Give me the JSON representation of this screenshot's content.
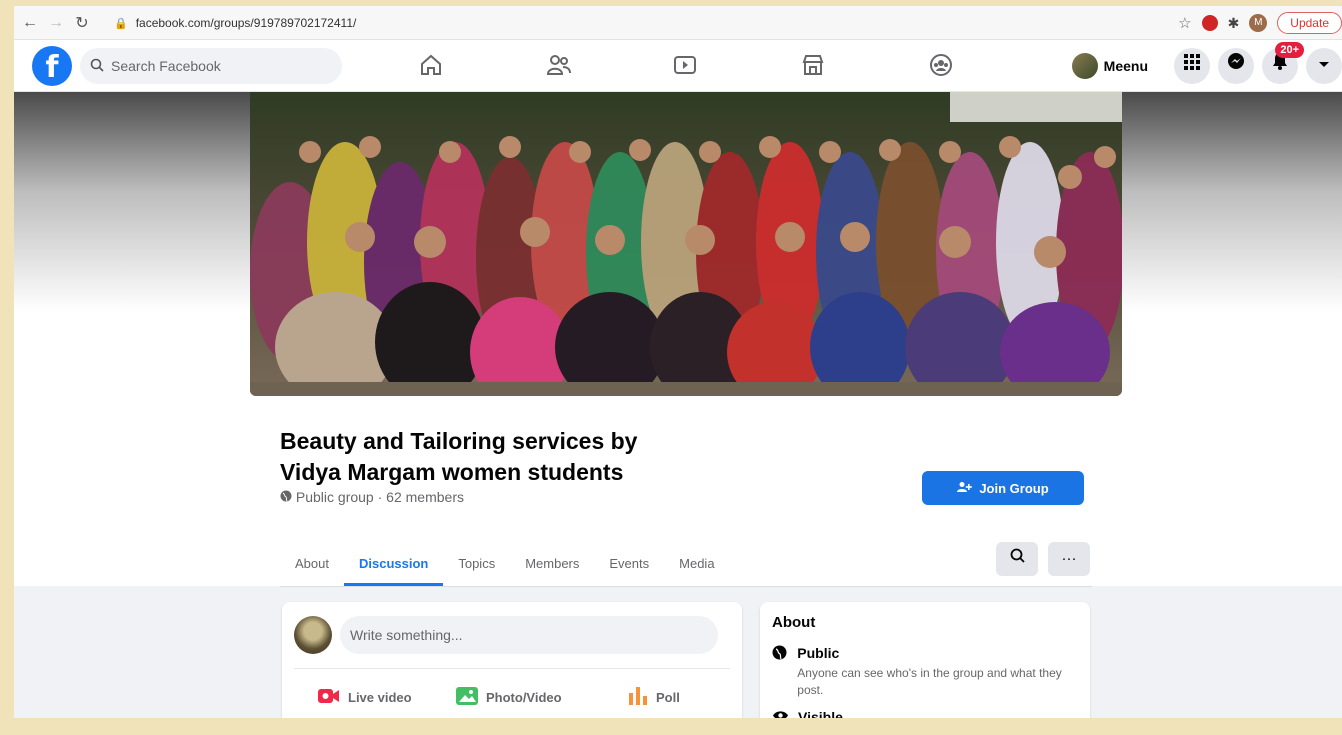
{
  "browser": {
    "url": "facebook.com/groups/919789702172411/",
    "update_label": "Update",
    "profile_initial": "M"
  },
  "header": {
    "logo": "f",
    "search_placeholder": "Search Facebook",
    "user_name": "Meenu",
    "notif_badge": "20+",
    "nav_icons": [
      "home-icon",
      "friends-icon",
      "watch-icon",
      "marketplace-icon",
      "groups-icon"
    ]
  },
  "group": {
    "name_line1": "Beauty and Tailoring services by",
    "name_line2": "Vidya Margam women students",
    "privacy": "Public group",
    "separator": " · ",
    "members": "62 members",
    "join_label": "Join Group"
  },
  "tabs": [
    "About",
    "Discussion",
    "Topics",
    "Members",
    "Events",
    "Media"
  ],
  "active_tab": "Discussion",
  "composer": {
    "placeholder": "Write something...",
    "live_label": "Live video",
    "photo_label": "Photo/Video",
    "poll_label": "Poll"
  },
  "about": {
    "title": "About",
    "public_title": "Public",
    "public_desc": "Anyone can see who's in the group and what they post.",
    "visible_title": "Visible"
  },
  "colors": {
    "brand": "#1877f2",
    "join_button": "#1b74e4",
    "badge": "#e41e3f"
  }
}
